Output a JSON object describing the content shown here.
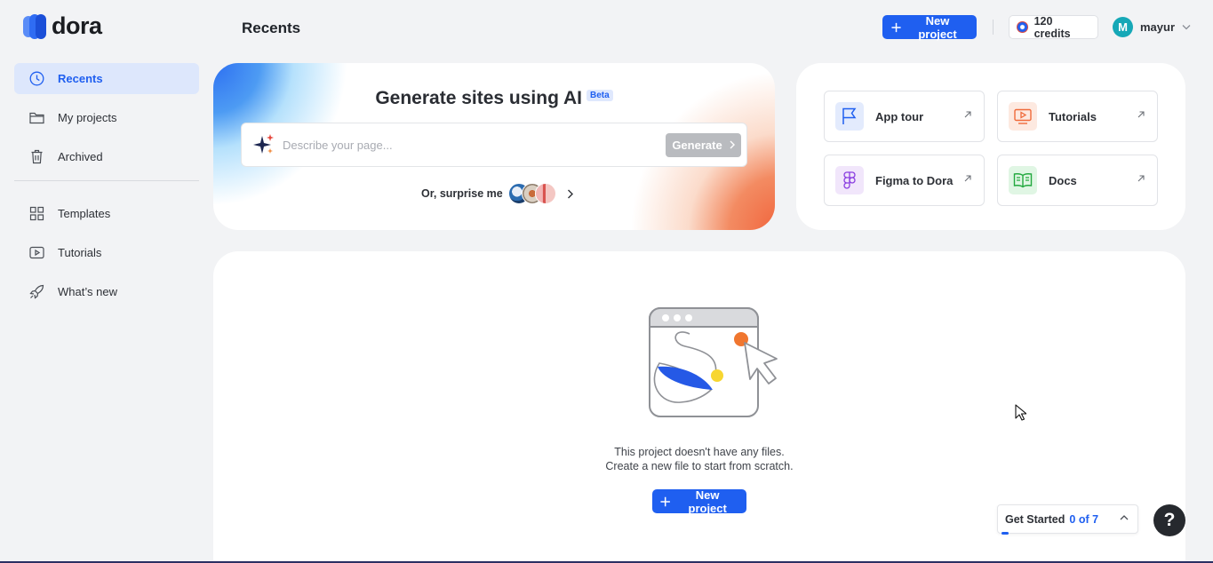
{
  "app": {
    "logo_text": "dora",
    "page_title": "Recents"
  },
  "header": {
    "new_project_label": "New project",
    "credits_label": "120 credits",
    "user_initial": "M",
    "user_name": "mayur"
  },
  "sidebar": {
    "items": [
      {
        "label": "Recents",
        "icon": "clock-icon",
        "active": true
      },
      {
        "label": "My projects",
        "icon": "folder-icon"
      },
      {
        "label": "Archived",
        "icon": "trash-icon"
      },
      {
        "label": "Templates",
        "icon": "grid-icon"
      },
      {
        "label": "Tutorials",
        "icon": "play-icon"
      },
      {
        "label": "What’s new",
        "icon": "rocket-icon"
      }
    ]
  },
  "hero": {
    "title": "Generate sites using AI",
    "badge": "Beta",
    "input_placeholder": "Describe your page...",
    "generate_label": "Generate",
    "surprise_label": "Or, surprise me"
  },
  "quick_links": [
    {
      "label": "App tour",
      "icon": "flag-icon"
    },
    {
      "label": "Tutorials",
      "icon": "video-icon"
    },
    {
      "label": "Figma to Dora",
      "icon": "figma-icon"
    },
    {
      "label": "Docs",
      "icon": "book-icon"
    }
  ],
  "empty_state": {
    "line1": "This project doesn't have any files.",
    "line2": "Create a new file to start from scratch.",
    "button_label": "New project"
  },
  "get_started": {
    "label": "Get Started",
    "count": "0 of 7",
    "progress": 0
  },
  "help": {
    "label": "?"
  },
  "colors": {
    "accent": "#1f5ff0",
    "background": "#f2f3f5",
    "card": "#ffffff"
  }
}
